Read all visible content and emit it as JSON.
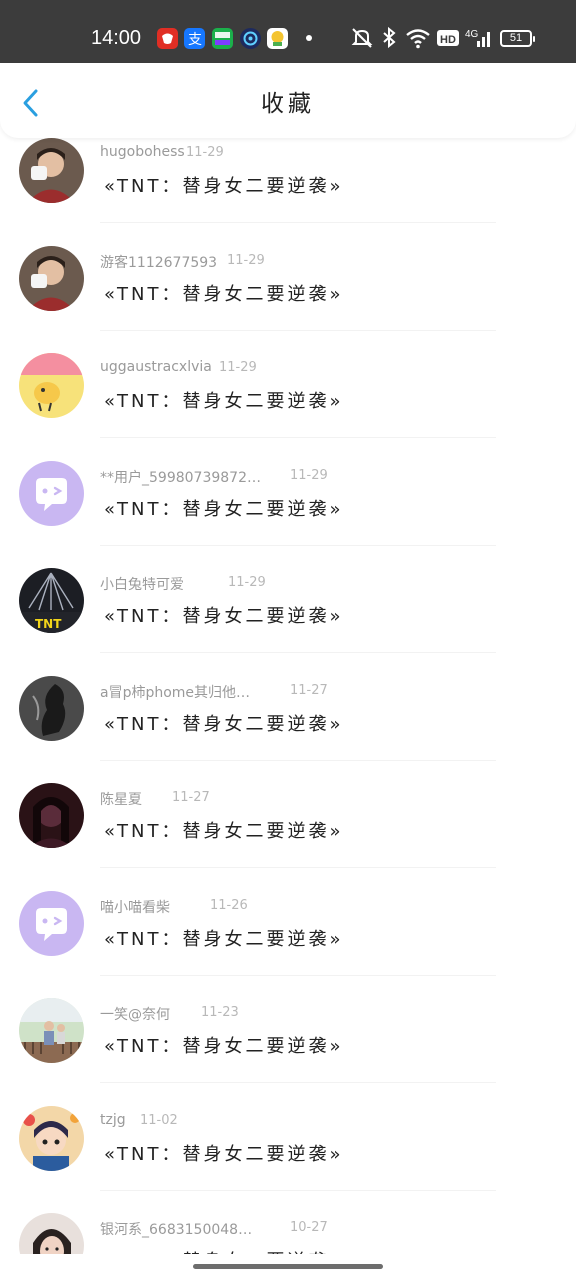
{
  "status_bar": {
    "time": "14:00",
    "battery": "51",
    "apps": [
      "pinduoduo-app-icon",
      "alipay-app-icon",
      "iqiyi-app-icon",
      "browser-app-icon",
      "game-app-icon"
    ],
    "system_icons": [
      "mute-icon",
      "bluetooth-icon",
      "wifi-icon",
      "hd-icon",
      "signal-4g-icon",
      "battery-icon"
    ],
    "hd_label": "HD",
    "network_label": "4G"
  },
  "header": {
    "title": "收藏",
    "accent_color": "#2a9fe0"
  },
  "items": [
    {
      "username": "hugobohess",
      "date": "11-29",
      "title": "«TNT：替身女二要逆袭»",
      "avatar": "photo"
    },
    {
      "username": "游客1112677593",
      "date": "11-29",
      "title": "«TNT：替身女二要逆袭»",
      "avatar": "photo"
    },
    {
      "username": "uggaustracxlvia",
      "date": "11-29",
      "title": "«TNT：替身女二要逆袭»",
      "avatar": "cartoon"
    },
    {
      "username": "**用户_59980739872…",
      "date": "11-29",
      "title": "«TNT：替身女二要逆袭»",
      "avatar": "default"
    },
    {
      "username": "小白兔特可爱",
      "date": "11-29",
      "title": "«TNT：替身女二要逆袭»",
      "avatar": "stage"
    },
    {
      "username": "a冒p柿phome其归他…",
      "date": "11-27",
      "title": "«TNT：替身女二要逆袭»",
      "avatar": "dark"
    },
    {
      "username": "陈星夏",
      "date": "11-27",
      "title": "«TNT：替身女二要逆袭»",
      "avatar": "photo-dark"
    },
    {
      "username": "喵小喵看柴",
      "date": "11-26",
      "title": "«TNT：替身女二要逆袭»",
      "avatar": "default"
    },
    {
      "username": "一笑@奈何",
      "date": "11-23",
      "title": "«TNT：替身女二要逆袭»",
      "avatar": "outdoor"
    },
    {
      "username": "tzjg",
      "date": "11-02",
      "title": "«TNT：替身女二要逆袭»",
      "avatar": "cartoon-girl"
    },
    {
      "username": "银河系_6683150048…",
      "date": "10-27",
      "title": "«TNT：替身女二要逆袭»",
      "avatar": "photo-girl"
    }
  ]
}
